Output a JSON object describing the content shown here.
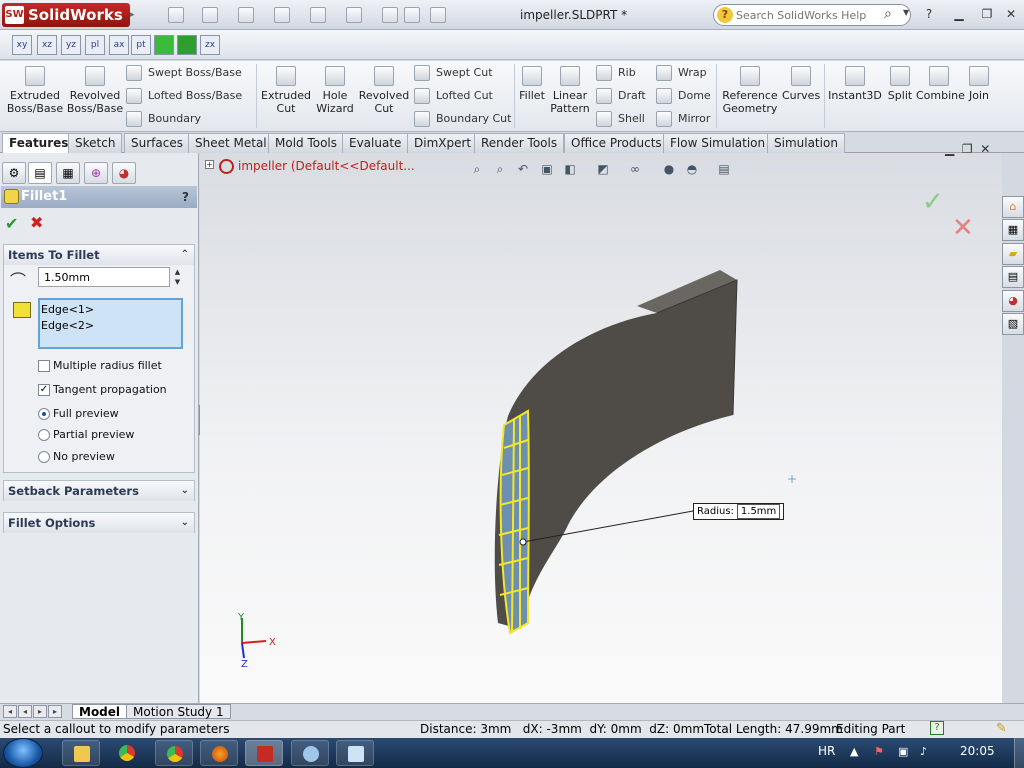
{
  "app": {
    "name": "SolidWorks",
    "doc_title": "impeller.SLDPRT *"
  },
  "search": {
    "placeholder": "Search SolidWorks Help"
  },
  "commands": {
    "extruded_boss": "Extruded Boss/Base",
    "revolved_boss": "Revolved Boss/Base",
    "swept_boss": "Swept Boss/Base",
    "lofted_boss": "Lofted Boss/Base",
    "boundary_boss": "Boundary Boss/Base",
    "extruded_cut": "Extruded Cut",
    "hole_wizard": "Hole Wizard",
    "revolved_cut": "Revolved Cut",
    "swept_cut": "Swept Cut",
    "lofted_cut": "Lofted Cut",
    "boundary_cut": "Boundary Cut",
    "fillet": "Fillet",
    "linear_pattern": "Linear Pattern",
    "rib": "Rib",
    "draft": "Draft",
    "shell": "Shell",
    "wrap": "Wrap",
    "dome": "Dome",
    "mirror": "Mirror",
    "reference_geometry": "Reference Geometry",
    "curves": "Curves",
    "instant3d": "Instant3D",
    "split": "Split",
    "combine": "Combine",
    "join": "Join"
  },
  "tabs": [
    "Features",
    "Sketch",
    "Surfaces",
    "Sheet Metal",
    "Mold Tools",
    "Evaluate",
    "DimXpert",
    "Render Tools",
    "Office Products",
    "Flow Simulation",
    "Simulation"
  ],
  "property_manager": {
    "title": "Fillet1",
    "help": "?",
    "items_section": "Items To Fillet",
    "radius_value": "1.50mm",
    "edges": [
      "Edge<1>",
      "Edge<2>"
    ],
    "multiple_radius": "Multiple radius fillet",
    "tangent_propagation": "Tangent propagation",
    "full_preview": "Full preview",
    "partial_preview": "Partial preview",
    "no_preview": "No preview",
    "setback_section": "Setback Parameters",
    "fillet_options_section": "Fillet Options",
    "multiple_radius_checked": false,
    "tangent_checked": true,
    "preview_selected": "Full preview"
  },
  "feature_tree": {
    "root": "impeller  (Default<<Default..."
  },
  "callout": {
    "label": "Radius:",
    "value": "1.5mm"
  },
  "triad": {
    "x": "X",
    "y": "Y",
    "z": "Z"
  },
  "bottom_tabs": [
    "Model",
    "Motion Study 1"
  ],
  "status": {
    "hint": "Select a callout to modify parameters",
    "measure": "Distance: 3mm   dX: -3mm  dY: 0mm  dZ: 0mmTotal Length: 47.99mm",
    "mode": "Editing Part",
    "help_q": "?"
  },
  "taskbar": {
    "lang": "HR",
    "clock": "20:05"
  },
  "colors": {
    "accent_red": "#c0201c",
    "selection_yellow": "#f5e62a",
    "part_gray": "#4f4c48"
  }
}
